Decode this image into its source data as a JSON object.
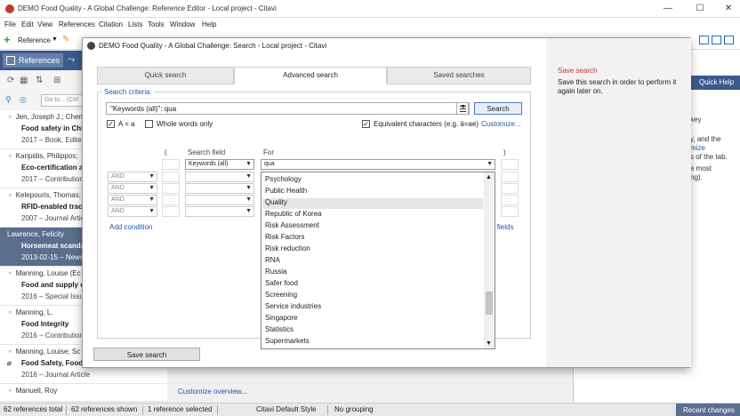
{
  "main_window": {
    "title": "DEMO Food Quality - A Global Challenge: Reference Editor - Local project - Citavi",
    "menu": [
      "File",
      "Edit",
      "View",
      "References",
      "Citation",
      "Lists",
      "Tools",
      "Window",
      "Help"
    ],
    "toolbar": {
      "reference_label": "Reference"
    },
    "references_tab": "References",
    "go_to_placeholder": "Go to... (Ctrl",
    "quick_help": "Quick Help",
    "right_panel": {
      "key_fragment": "key",
      "line1": "y, and the",
      "link_fragment": "mize",
      "line2": "s of the tab.",
      "line3": "e most",
      "line4": "ng)."
    },
    "customize_overview": "Customize overview...",
    "references": [
      {
        "author": "Jen, Joseph J.; Chen,",
        "title": "Food safety in Chin",
        "meta": "2017 – Book, Edited",
        "selected": false,
        "attachment": false
      },
      {
        "author": "Karipidis, Philippos;",
        "title": "Eco-certification an",
        "meta": "2017 – Contribution",
        "selected": false,
        "attachment": false
      },
      {
        "author": "Kelepouris, Thomas;",
        "title": "RFID-enabled trace",
        "meta": "2007 – Journal Article",
        "selected": false,
        "attachment": false
      },
      {
        "author": "Lawrence, Felicity",
        "title": "Horsemeat scandal",
        "meta": "2013-02-15 – News",
        "selected": true,
        "attachment": false
      },
      {
        "author": "Manning, Louise (Ec",
        "title": "Food and supply ch",
        "meta": "2016 – Special Issue",
        "selected": false,
        "attachment": false
      },
      {
        "author": "Manning, L.",
        "title": "Food Integrity",
        "meta": "2016 – Contribution",
        "selected": false,
        "attachment": false
      },
      {
        "author": "Manning, Louise; Sc",
        "title": "Food Safety, Food I",
        "meta": "2016 – Journal Article",
        "selected": false,
        "attachment": true
      },
      {
        "author": "Manuell, Roy",
        "title": "",
        "meta": "",
        "selected": false,
        "attachment": false
      }
    ],
    "statusbar": {
      "total": "62 references total",
      "shown": "62 references shown",
      "selected": "1 reference selected",
      "style": "Citavi Default Style",
      "grouping": "No grouping",
      "recent_changes": "Recent changes"
    }
  },
  "dialog": {
    "title": "DEMO Food Quality - A Global Challenge: Search - Local project - Citavi",
    "tabs": [
      "Quick search",
      "Advanced search",
      "Saved searches"
    ],
    "active_tab": "Advanced search",
    "criteria_label": "Search criteria:",
    "query": "\"Keywords (all)\": qua",
    "search_button": "Search",
    "options": {
      "case_label": "A = a",
      "case_checked": true,
      "whole_words_label": "Whole words only",
      "whole_words_checked": false,
      "equiv_label": "Equivalent characters (e.g. ä=ae)",
      "equiv_checked": true,
      "customize": "Customize..."
    },
    "columns": {
      "open_paren": "(",
      "field": "Search field",
      "for": "For",
      "close_paren": ")"
    },
    "row1": {
      "field": "Keywords (all)",
      "value": "qua"
    },
    "operators": [
      "AND",
      "AND",
      "AND",
      "AND"
    ],
    "add_condition": "Add condition",
    "all_fields_fragment": "ll fields",
    "dropdown_items": [
      "Psychology",
      "Public Health",
      "Quality",
      "Republic of Korea",
      "Risk Assessment",
      "Risk Factors",
      "Risk reduction",
      "RNA",
      "Russia",
      "Safer food",
      "Screening",
      "Service industries",
      "Singapore",
      "Statistics",
      "Supermarkets"
    ],
    "dropdown_highlight": "Quality",
    "save_search_button": "Save search",
    "save_panel": {
      "heading": "Save search",
      "text": "Save this search in order to perform it again later on."
    }
  },
  "colors": {
    "accent_blue": "#3b5b8c",
    "selection": "#5a6e8e",
    "link": "#1a5aa8",
    "save_heading": "#c0392b"
  }
}
